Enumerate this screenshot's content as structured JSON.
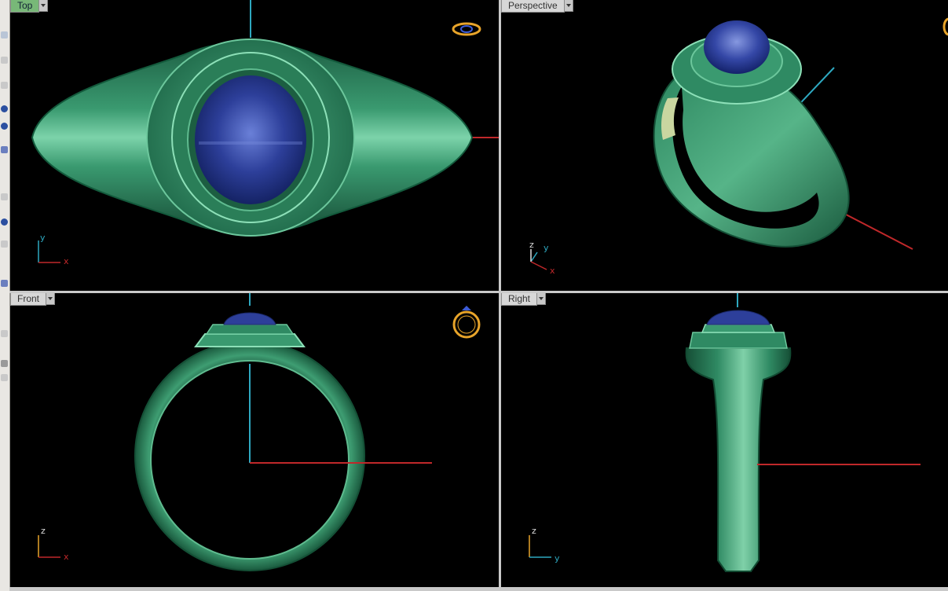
{
  "viewports": {
    "top": {
      "label": "Top",
      "active": true,
      "axis_a": "y",
      "axis_b": "x"
    },
    "perspective": {
      "label": "Perspective",
      "active": false,
      "axis_a": "z",
      "axis_b": "y",
      "axis_c": "x"
    },
    "front": {
      "label": "Front",
      "active": false,
      "axis_a": "z",
      "axis_b": "x"
    },
    "right": {
      "label": "Right",
      "active": false,
      "axis_a": "z",
      "axis_b": "y"
    }
  },
  "colors": {
    "background": "#000000",
    "ring_metal": "#2f8a63",
    "gem": "#2d3f9a",
    "axis_x": "#c0282a",
    "axis_y": "#2ea8c0",
    "active_tab": "#78b878"
  },
  "icons": [
    "ring-top-view-icon",
    "ring-perspective-icon",
    "ring-front-view-icon",
    "dropdown-arrow-icon"
  ]
}
